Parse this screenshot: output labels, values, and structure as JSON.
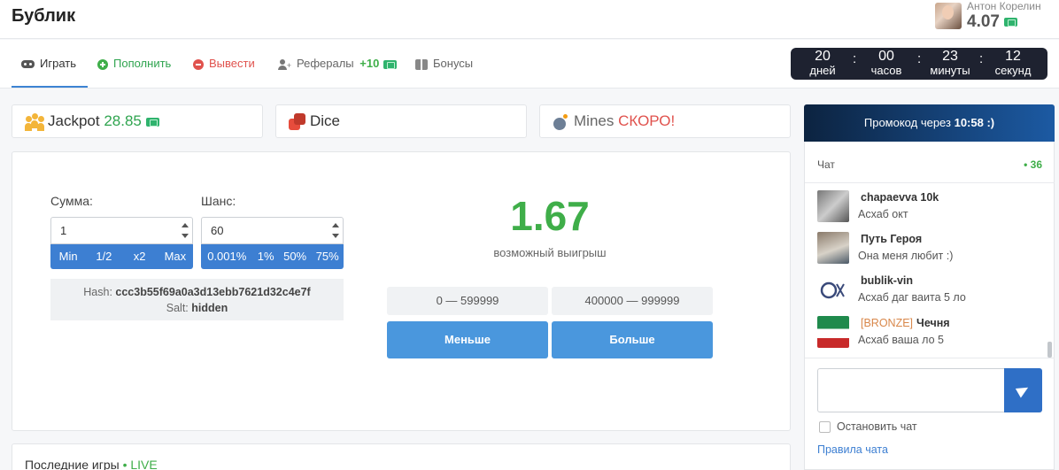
{
  "brand": "Бублик",
  "user": {
    "name": "Антон Корелин",
    "balance": "4.07"
  },
  "nav": {
    "play": "Играть",
    "deposit": "Пополнить",
    "withdraw": "Вывести",
    "referrals": "Рефералы",
    "referrals_bonus": "+10",
    "bonuses": "Бонусы"
  },
  "countdown": {
    "days": "20",
    "days_label": "дней",
    "hours": "00",
    "hours_label": "часов",
    "minutes": "23",
    "minutes_label": "минуты",
    "seconds": "12",
    "seconds_label": "секунд",
    "separator": ":"
  },
  "games": {
    "jackpot_label": "Jackpot",
    "jackpot_value": "28.85",
    "dice_label": "Dice",
    "mines_label": "Mines",
    "mines_status": "СКОРО!"
  },
  "dice": {
    "amount_label": "Сумма:",
    "amount_value": "1",
    "amount_buttons": [
      "Min",
      "1/2",
      "x2",
      "Max"
    ],
    "chance_label": "Шанс:",
    "chance_value": "60",
    "chance_buttons": [
      "0.001%",
      "1%",
      "50%",
      "75%"
    ],
    "hash_label": "Hash:",
    "hash_value": "ccc3b55f69a0a3d13ebb7621d32c4e7f",
    "salt_label": "Salt:",
    "salt_value": "hidden",
    "possible_win": "1.67",
    "possible_win_label": "возможный выигрыш",
    "range_low": "0 — 599999",
    "range_high": "400000 — 999999",
    "less_button": "Меньше",
    "more_button": "Больше"
  },
  "recent": {
    "title": "Последние игры",
    "live": "• LIVE"
  },
  "promo": {
    "text": "Промокод через",
    "time": "10:58 :)"
  },
  "chat": {
    "title": "Чат",
    "online": "• 36",
    "messages": [
      {
        "tag": "",
        "name": "chapaevva 10k",
        "text": "Асхаб окт"
      },
      {
        "tag": "",
        "name": "Путь Героя",
        "text": "Она меня любит :)"
      },
      {
        "tag": "",
        "name": "bublik-vin",
        "text": "Асхаб даг ваита 5 ло"
      },
      {
        "tag": "[BRONZE]",
        "name": "Чечня",
        "text": "Асхаб ваша ло 5"
      }
    ],
    "stop_chat_label": "Остановить чат",
    "rules_link": "Правила чата"
  },
  "colors": {
    "accent": "#3d7fd2",
    "green": "#3fae49",
    "red": "#e0524d",
    "timer_bg": "#1e2230"
  }
}
